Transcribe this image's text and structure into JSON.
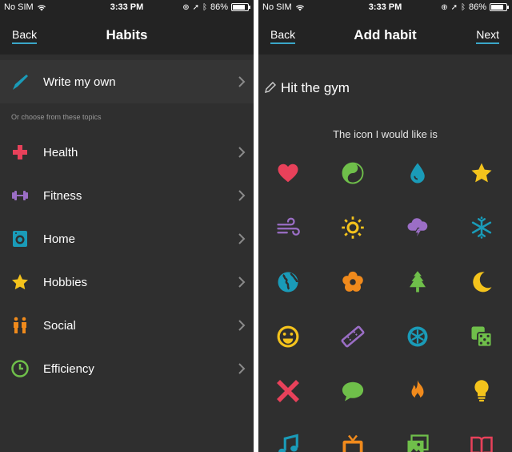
{
  "status": {
    "carrier": "No SIM",
    "time": "3:33 PM",
    "battery": "86%",
    "battery_level": 0.86
  },
  "left": {
    "title": "Habits",
    "back_label": "Back",
    "write_own": "Write my own",
    "hint": "Or choose from these topics",
    "topics": [
      {
        "label": "Health",
        "icon": "health-cross-icon",
        "color": "#e8415a"
      },
      {
        "label": "Fitness",
        "icon": "dumbbell-icon",
        "color": "#9b6ec6"
      },
      {
        "label": "Home",
        "icon": "washing-machine-icon",
        "color": "#1a9bb8"
      },
      {
        "label": "Hobbies",
        "icon": "star-icon",
        "color": "#f4c31c"
      },
      {
        "label": "Social",
        "icon": "people-icon",
        "color": "#f08a1c"
      },
      {
        "label": "Efficiency",
        "icon": "clock-icon",
        "color": "#6fbf4a"
      }
    ]
  },
  "right": {
    "title": "Add habit",
    "back_label": "Back",
    "next_label": "Next",
    "habit_value": "Hit the gym",
    "icon_prompt": "The icon I would like is",
    "icons": [
      {
        "name": "heart-icon",
        "color": "#e8415a"
      },
      {
        "name": "yin-yang-icon",
        "color": "#6fbf4a"
      },
      {
        "name": "water-drop-icon",
        "color": "#1a9bb8"
      },
      {
        "name": "star-icon",
        "color": "#f4c31c"
      },
      {
        "name": "wind-icon",
        "color": "#9b6ec6"
      },
      {
        "name": "sun-icon",
        "color": "#f4c31c"
      },
      {
        "name": "storm-cloud-icon",
        "color": "#9b6ec6"
      },
      {
        "name": "snowflake-icon",
        "color": "#1a9bb8"
      },
      {
        "name": "globe-icon",
        "color": "#1a9bb8"
      },
      {
        "name": "flower-icon",
        "color": "#f08a1c"
      },
      {
        "name": "tree-icon",
        "color": "#6fbf4a"
      },
      {
        "name": "moon-icon",
        "color": "#f4c31c"
      },
      {
        "name": "smiley-icon",
        "color": "#f4c31c"
      },
      {
        "name": "ticket-icon",
        "color": "#9b6ec6"
      },
      {
        "name": "asterisk-badge-icon",
        "color": "#1a9bb8"
      },
      {
        "name": "dice-icon",
        "color": "#6fbf4a"
      },
      {
        "name": "cross-icon",
        "color": "#e8415a"
      },
      {
        "name": "speech-bubble-icon",
        "color": "#6fbf4a"
      },
      {
        "name": "flame-icon",
        "color": "#f08a1c"
      },
      {
        "name": "lightbulb-icon",
        "color": "#f4c31c"
      },
      {
        "name": "music-note-icon",
        "color": "#1a9bb8"
      },
      {
        "name": "tv-icon",
        "color": "#f08a1c"
      },
      {
        "name": "photos-icon",
        "color": "#6fbf4a"
      },
      {
        "name": "book-icon",
        "color": "#e8415a"
      }
    ]
  }
}
